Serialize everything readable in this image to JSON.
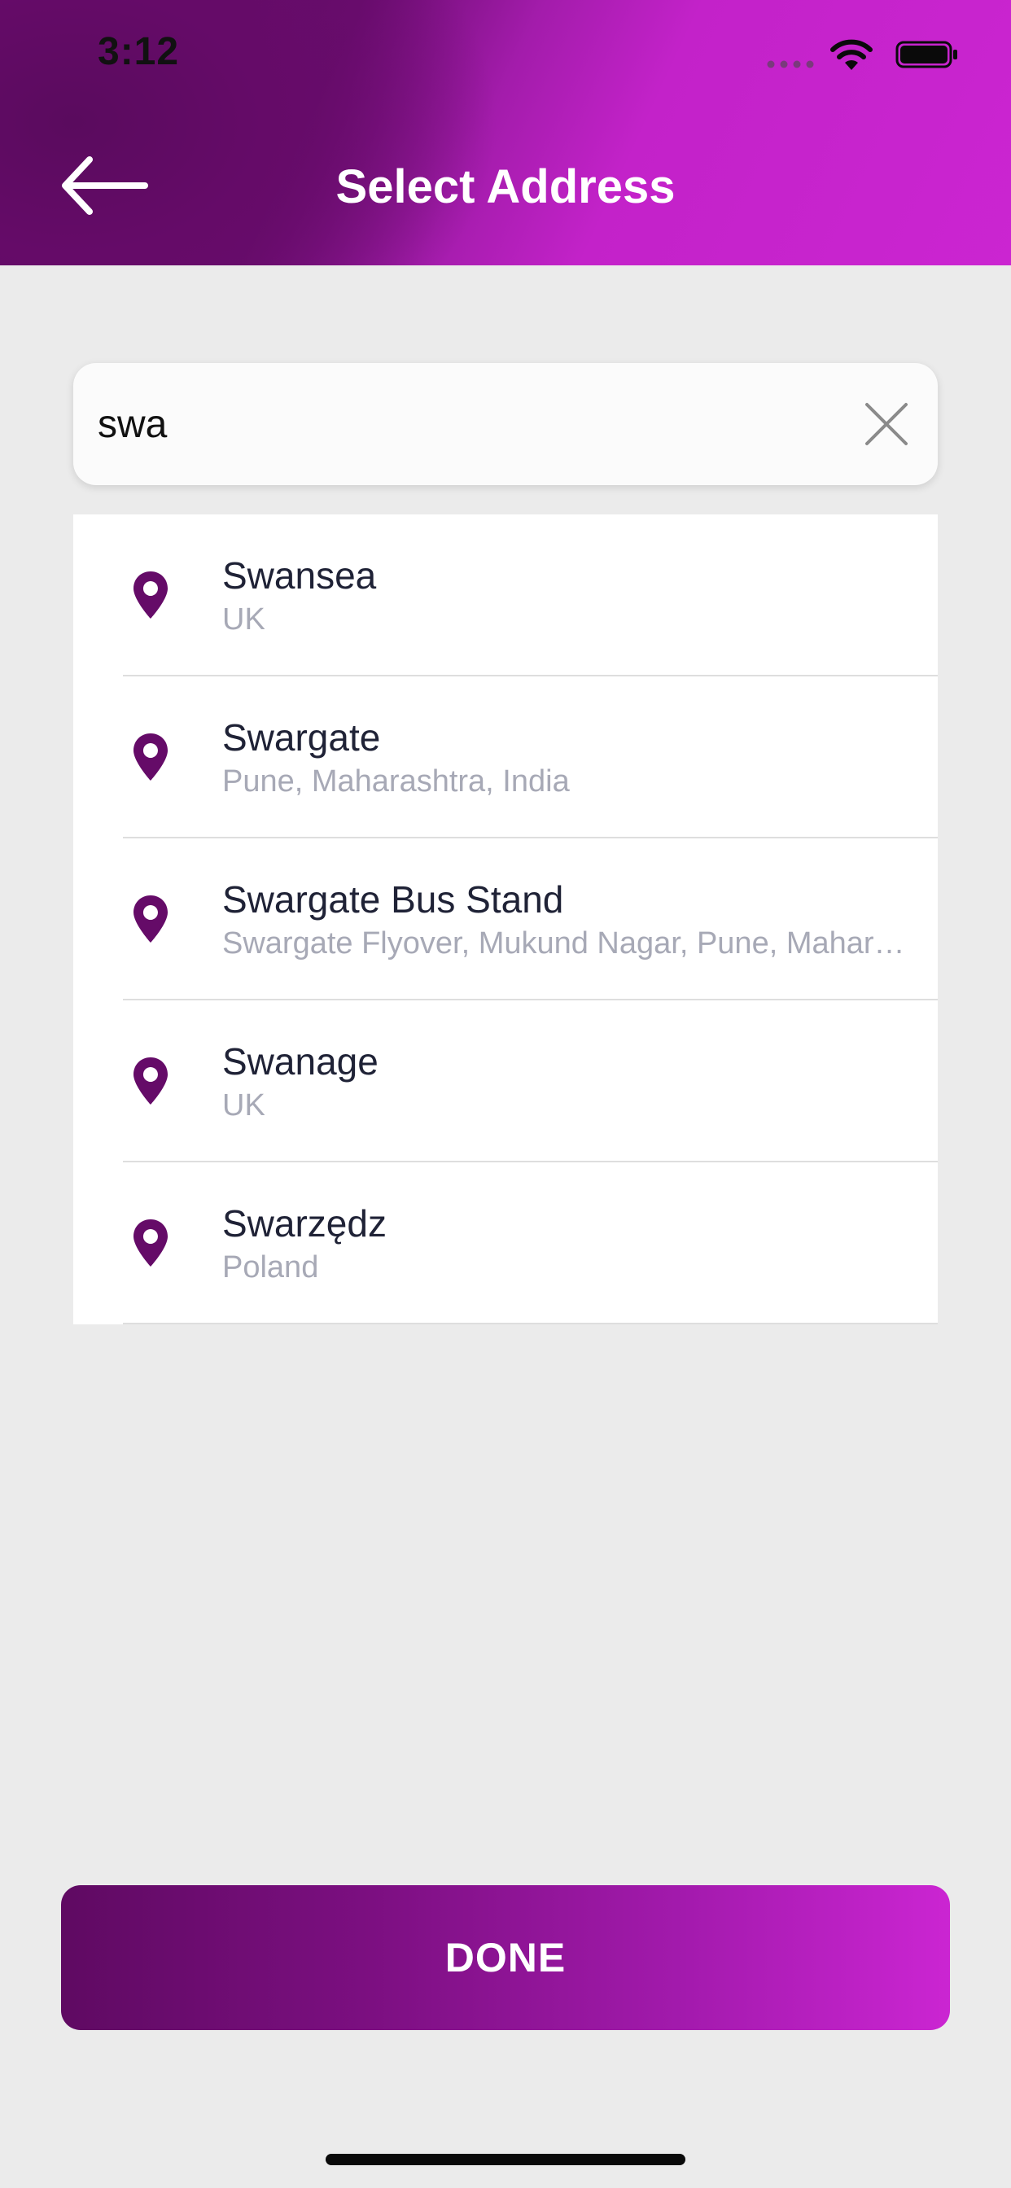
{
  "status_bar": {
    "time": "3:12"
  },
  "header": {
    "title": "Select Address"
  },
  "search": {
    "value": "swa",
    "placeholder": ""
  },
  "results": [
    {
      "name": "Swansea",
      "detail": "UK"
    },
    {
      "name": "Swargate",
      "detail": "Pune, Maharashtra, India"
    },
    {
      "name": "Swargate Bus Stand",
      "detail": "Swargate Flyover, Mukund Nagar, Pune, Maharashtra, India"
    },
    {
      "name": "Swanage",
      "detail": "UK"
    },
    {
      "name": "Swarzędz",
      "detail": "Poland"
    }
  ],
  "footer": {
    "done_label": "DONE"
  },
  "colors": {
    "brand_dark": "#5f0a62",
    "brand_light": "#cb25d2",
    "pin": "#650b68",
    "background": "#ebebeb"
  },
  "icons": {
    "back": "arrow-left-icon",
    "clear": "close-icon",
    "result": "location-pin-icon"
  }
}
